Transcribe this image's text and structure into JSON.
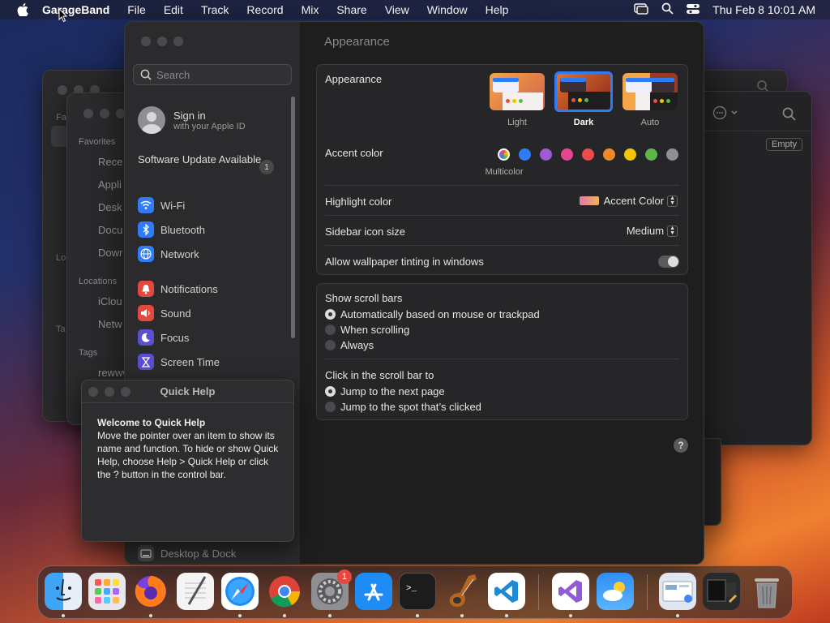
{
  "menubar": {
    "app": "GarageBand",
    "items": [
      "File",
      "Edit",
      "Track",
      "Record",
      "Mix",
      "Share",
      "View",
      "Window",
      "Help"
    ],
    "clock": "Thu Feb 8  10:01 AM"
  },
  "finder_bg": {
    "favorites_header": "Favorites",
    "favorites": [
      "Rece",
      "Appli",
      "Desk",
      "Docu",
      "Dowr"
    ],
    "locations_header": "Locations",
    "locations": [
      "iClou",
      "Netw"
    ],
    "tags_header": "Tags",
    "tags": [
      "rewww"
    ],
    "lo": "Lo",
    "ta": "Ta",
    "fa": "Fa"
  },
  "bg_right": {
    "empty_badge": "Empty"
  },
  "sidebar": {
    "search_placeholder": "Search",
    "signin_title": "Sign in",
    "signin_sub": "with your Apple ID",
    "software_update": "Software Update Available",
    "update_count": "1",
    "items": [
      {
        "label": "Wi-Fi",
        "icon": "wifi-icon",
        "color": "#2f7cf6"
      },
      {
        "label": "Bluetooth",
        "icon": "bluetooth-icon",
        "color": "#2f7cf6"
      },
      {
        "label": "Network",
        "icon": "globe-icon",
        "color": "#2f7cf6"
      },
      {
        "label": "Notifications",
        "icon": "bell-icon",
        "color": "#e5483f"
      },
      {
        "label": "Sound",
        "icon": "speaker-icon",
        "color": "#e5483f"
      },
      {
        "label": "Focus",
        "icon": "moon-icon",
        "color": "#5b4fd1"
      },
      {
        "label": "Screen Time",
        "icon": "hourglass-icon",
        "color": "#5b4fd1"
      },
      {
        "label": "Desktop & Dock",
        "icon": "dock-icon",
        "color": "#555"
      }
    ]
  },
  "main": {
    "title": "Appearance",
    "appearance_label": "Appearance",
    "appearance_options": [
      "Light",
      "Dark",
      "Auto"
    ],
    "selected_appearance": "Dark",
    "accent_label": "Accent color",
    "accent_selected_name": "Multicolor",
    "accent_colors": [
      "multicolor",
      "#2f7cf6",
      "#9d5bd2",
      "#e6468f",
      "#ec4b4b",
      "#f08a24",
      "#f5c400",
      "#5bb846",
      "#8e8e93"
    ],
    "highlight_label": "Highlight color",
    "highlight_value": "Accent Color",
    "sidebar_icon_label": "Sidebar icon size",
    "sidebar_icon_value": "Medium",
    "tinting_label": "Allow wallpaper tinting in windows",
    "scroll_header": "Show scroll bars",
    "scroll_options": [
      "Automatically based on mouse or trackpad",
      "When scrolling",
      "Always"
    ],
    "scroll_selected": 0,
    "click_header": "Click in the scroll bar to",
    "click_options": [
      "Jump to the next page",
      "Jump to the spot that’s clicked"
    ],
    "click_selected": 0,
    "help": "?"
  },
  "quick_help": {
    "title": "Quick Help",
    "heading": "Welcome to Quick Help",
    "body": "Move the pointer over an item to show its name and function. To hide or show Quick Help, choose Help > Quick Help or click the ? button in the control bar."
  },
  "dock": {
    "items": [
      "finder",
      "launchpad",
      "firefox",
      "textedit",
      "safari",
      "chrome",
      "system-settings",
      "app-store",
      "terminal",
      "garageband",
      "vscode",
      "visual-studio",
      "weather",
      "preview",
      "screenshot",
      "trash"
    ],
    "settings_badge": "1"
  }
}
